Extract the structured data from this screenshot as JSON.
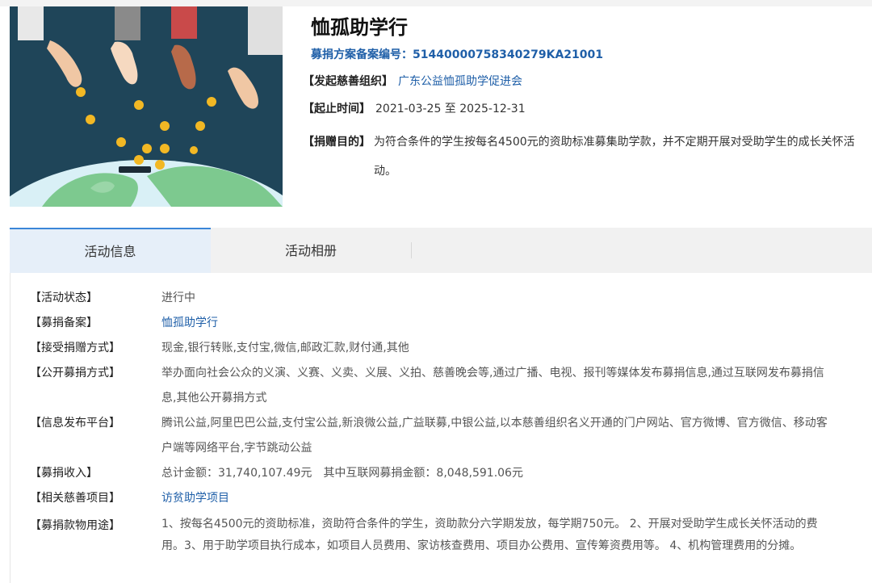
{
  "project": {
    "title": "恤孤助学行",
    "record_line": "募捐方案备案编号：51440000758340279KA21001",
    "organizer_label": "【发起慈善组织】",
    "organizer": "广东公益恤孤助学促进会",
    "period_label": "【起止时间】",
    "period": "2021-03-25 至 2025-12-31",
    "purpose_label": "【捐赠目的】",
    "purpose": "为符合条件的学生按每名4500元的资助标准募集助学款，并不定期开展对受助学生的成长关怀活动。"
  },
  "tabs": [
    {
      "label": "活动信息",
      "active": true
    },
    {
      "label": "活动相册",
      "active": false
    }
  ],
  "details": {
    "status_label": "【活动状态】",
    "status": "进行中",
    "record_label": "【募捐备案】",
    "record": "恤孤助学行",
    "methods_label": "【接受捐赠方式】",
    "methods": "现金,银行转账,支付宝,微信,邮政汇款,财付通,其他",
    "public_label": "【公开募捐方式】",
    "public": "举办面向社会公众的义演、义赛、义卖、义展、义拍、慈善晚会等,通过广播、电视、报刊等媒体发布募捐信息,通过互联网发布募捐信息,其他公开募捐方式",
    "platform_label": "【信息发布平台】",
    "platform": "腾讯公益,阿里巴巴公益,支付宝公益,新浪微公益,广益联募,中银公益,以本慈善组织名义开通的门户网站、官方微博、官方微信、移动客户端等网络平台,字节跳动公益",
    "income_label": "【募捐收入】",
    "income_total": "总计金额：31,740,107.49元",
    "income_online": "其中互联网募捐金额：8,048,591.06元",
    "related_label": "【相关慈善项目】",
    "related": "访贫助学项目",
    "usage_label": "【募捐款物用途】",
    "usage": "1、按每名4500元的资助标准，资助符合条件的学生，资助款分六学期发放，每学期750元。 2、开展对受助学生成长关怀活动的费用。3、用于助学项目执行成本，如项目人员费用、家访核查费用、项目办公费用、宣传筹资费用等。 4、机构管理费用的分摊。"
  },
  "colors": {
    "link": "#1f5fa8",
    "tab_active_bg": "#e6eff9",
    "tab_active_border": "#3a86d8",
    "cover_bg": "#1f4559",
    "coin": "#f2b824",
    "globe": "#7dc98f"
  }
}
